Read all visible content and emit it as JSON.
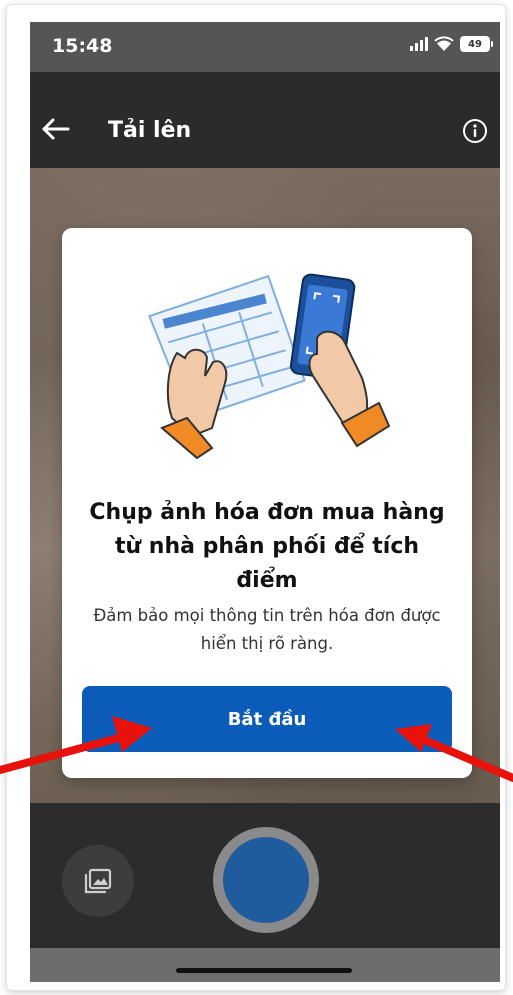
{
  "status_bar": {
    "time": "15:48",
    "battery_level": "49",
    "icons": [
      "signal-icon",
      "wifi-icon",
      "battery-icon"
    ]
  },
  "app_bar": {
    "title": "Tải lên",
    "back_icon": "arrow-left-icon",
    "info_icon": "info-icon"
  },
  "dialog": {
    "title": "Chụp ảnh hóa đơn mua hàng từ nhà phân phối để tích điểm",
    "description": "Đảm bảo mọi thông tin trên hóa đơn được hiển thị rõ ràng.",
    "start_button_label": "Bắt đầu"
  },
  "camera_controls": {
    "gallery_icon": "gallery-icon",
    "shutter_icon": "shutter-button"
  },
  "colors": {
    "primary": "#0b5cb8",
    "app_bar_bg": "#2b2b2b",
    "shutter": "#1f5c9e",
    "annotation_arrow": "#e8120c"
  }
}
